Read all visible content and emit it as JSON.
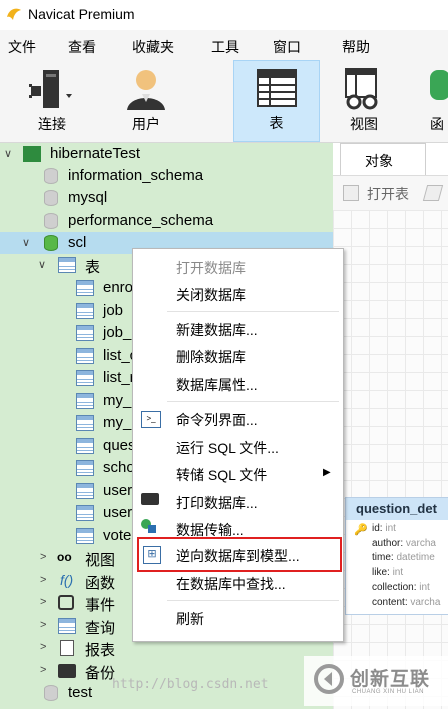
{
  "window": {
    "title": "Navicat Premium"
  },
  "menubar": [
    "文件",
    "查看",
    "收藏夹",
    "工具",
    "窗口",
    "帮助"
  ],
  "toolbar": [
    {
      "label": "连接",
      "icon": "connect-icon"
    },
    {
      "label": "用户",
      "icon": "user-icon"
    },
    {
      "label": "表",
      "icon": "table-icon",
      "active": true
    },
    {
      "label": "视图",
      "icon": "view-icon"
    },
    {
      "label": "函",
      "icon": "function-icon"
    }
  ],
  "tree": {
    "connection": "hibernateTest",
    "databases": [
      "information_schema",
      "mysql",
      "performance_schema",
      "scl"
    ],
    "tables_node": "表",
    "tables": [
      "enro",
      "job",
      "job_",
      "list_c",
      "list_r",
      "my_r",
      "my_r",
      "ques",
      "scho",
      "user",
      "user",
      "vote"
    ],
    "other_nodes": [
      "视图",
      "函数",
      "事件",
      "查询",
      "报表",
      "备份"
    ],
    "last_db": "test"
  },
  "right_panel": {
    "tab": "对象",
    "toolbar": {
      "open_table": "打开表"
    },
    "model_card": {
      "title": "question_det",
      "fields": [
        {
          "name": "id",
          "type": "int"
        },
        {
          "name": "author",
          "type": "varcha"
        },
        {
          "name": "time",
          "type": "datetime"
        },
        {
          "name": "like",
          "type": "int"
        },
        {
          "name": "collection",
          "type": "int"
        },
        {
          "name": "content",
          "type": "varcha"
        }
      ]
    }
  },
  "context_menu": {
    "items": [
      {
        "label": "打开数据库",
        "disabled": true
      },
      {
        "label": "关闭数据库"
      },
      {
        "label": "新建数据库..."
      },
      {
        "label": "删除数据库"
      },
      {
        "label": "数据库属性..."
      },
      {
        "label": "命令列界面..."
      },
      {
        "label": "运行 SQL 文件..."
      },
      {
        "label": "转储 SQL 文件",
        "submenu": "▶"
      },
      {
        "label": "打印数据库..."
      },
      {
        "label": "数据传输..."
      },
      {
        "label": "逆向数据库到模型...",
        "highlighted": true
      },
      {
        "label": "在数据库中查找..."
      },
      {
        "label": "刷新"
      }
    ]
  },
  "watermark": {
    "url": "http://blog.csdn.net",
    "brand": "创新互联",
    "brand_sub": "CHUANG XIN HU LIAN"
  },
  "colors": {
    "tree_bg": "#d5ecd1",
    "selection": "#b6dcef",
    "highlight_box": "#e02020",
    "toolbar_active": "#cde8fb"
  }
}
